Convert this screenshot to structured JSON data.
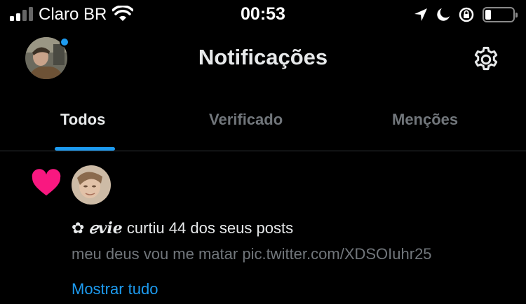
{
  "status_bar": {
    "carrier": "Claro BR",
    "time": "00:53",
    "icons": [
      "signal-icon",
      "wifi-icon",
      "location-icon",
      "moon-icon",
      "orientation-lock-icon",
      "battery-icon"
    ],
    "battery_level": 0.2
  },
  "header": {
    "title": "Notificações",
    "avatar_icon": "profile-avatar",
    "online_indicator_color": "#1d9bf0",
    "settings_icon": "gear-icon"
  },
  "tabs": [
    {
      "label": "Todos",
      "active": true
    },
    {
      "label": "Verificado",
      "active": false
    },
    {
      "label": "Menções",
      "active": false
    }
  ],
  "notification": {
    "type_icon": "heart-icon",
    "type_color": "#f91880",
    "user_prefix": "✿",
    "user_name": "𝑒vie",
    "action_text": "curtiu 44 dos seus posts",
    "preview": "meu deus vou me matar pic.twitter.com/XDSOIuhr25",
    "show_all": "Mostrar tudo"
  },
  "colors": {
    "accent": "#1d9bf0",
    "background": "#000000",
    "muted_text": "#71767b"
  }
}
